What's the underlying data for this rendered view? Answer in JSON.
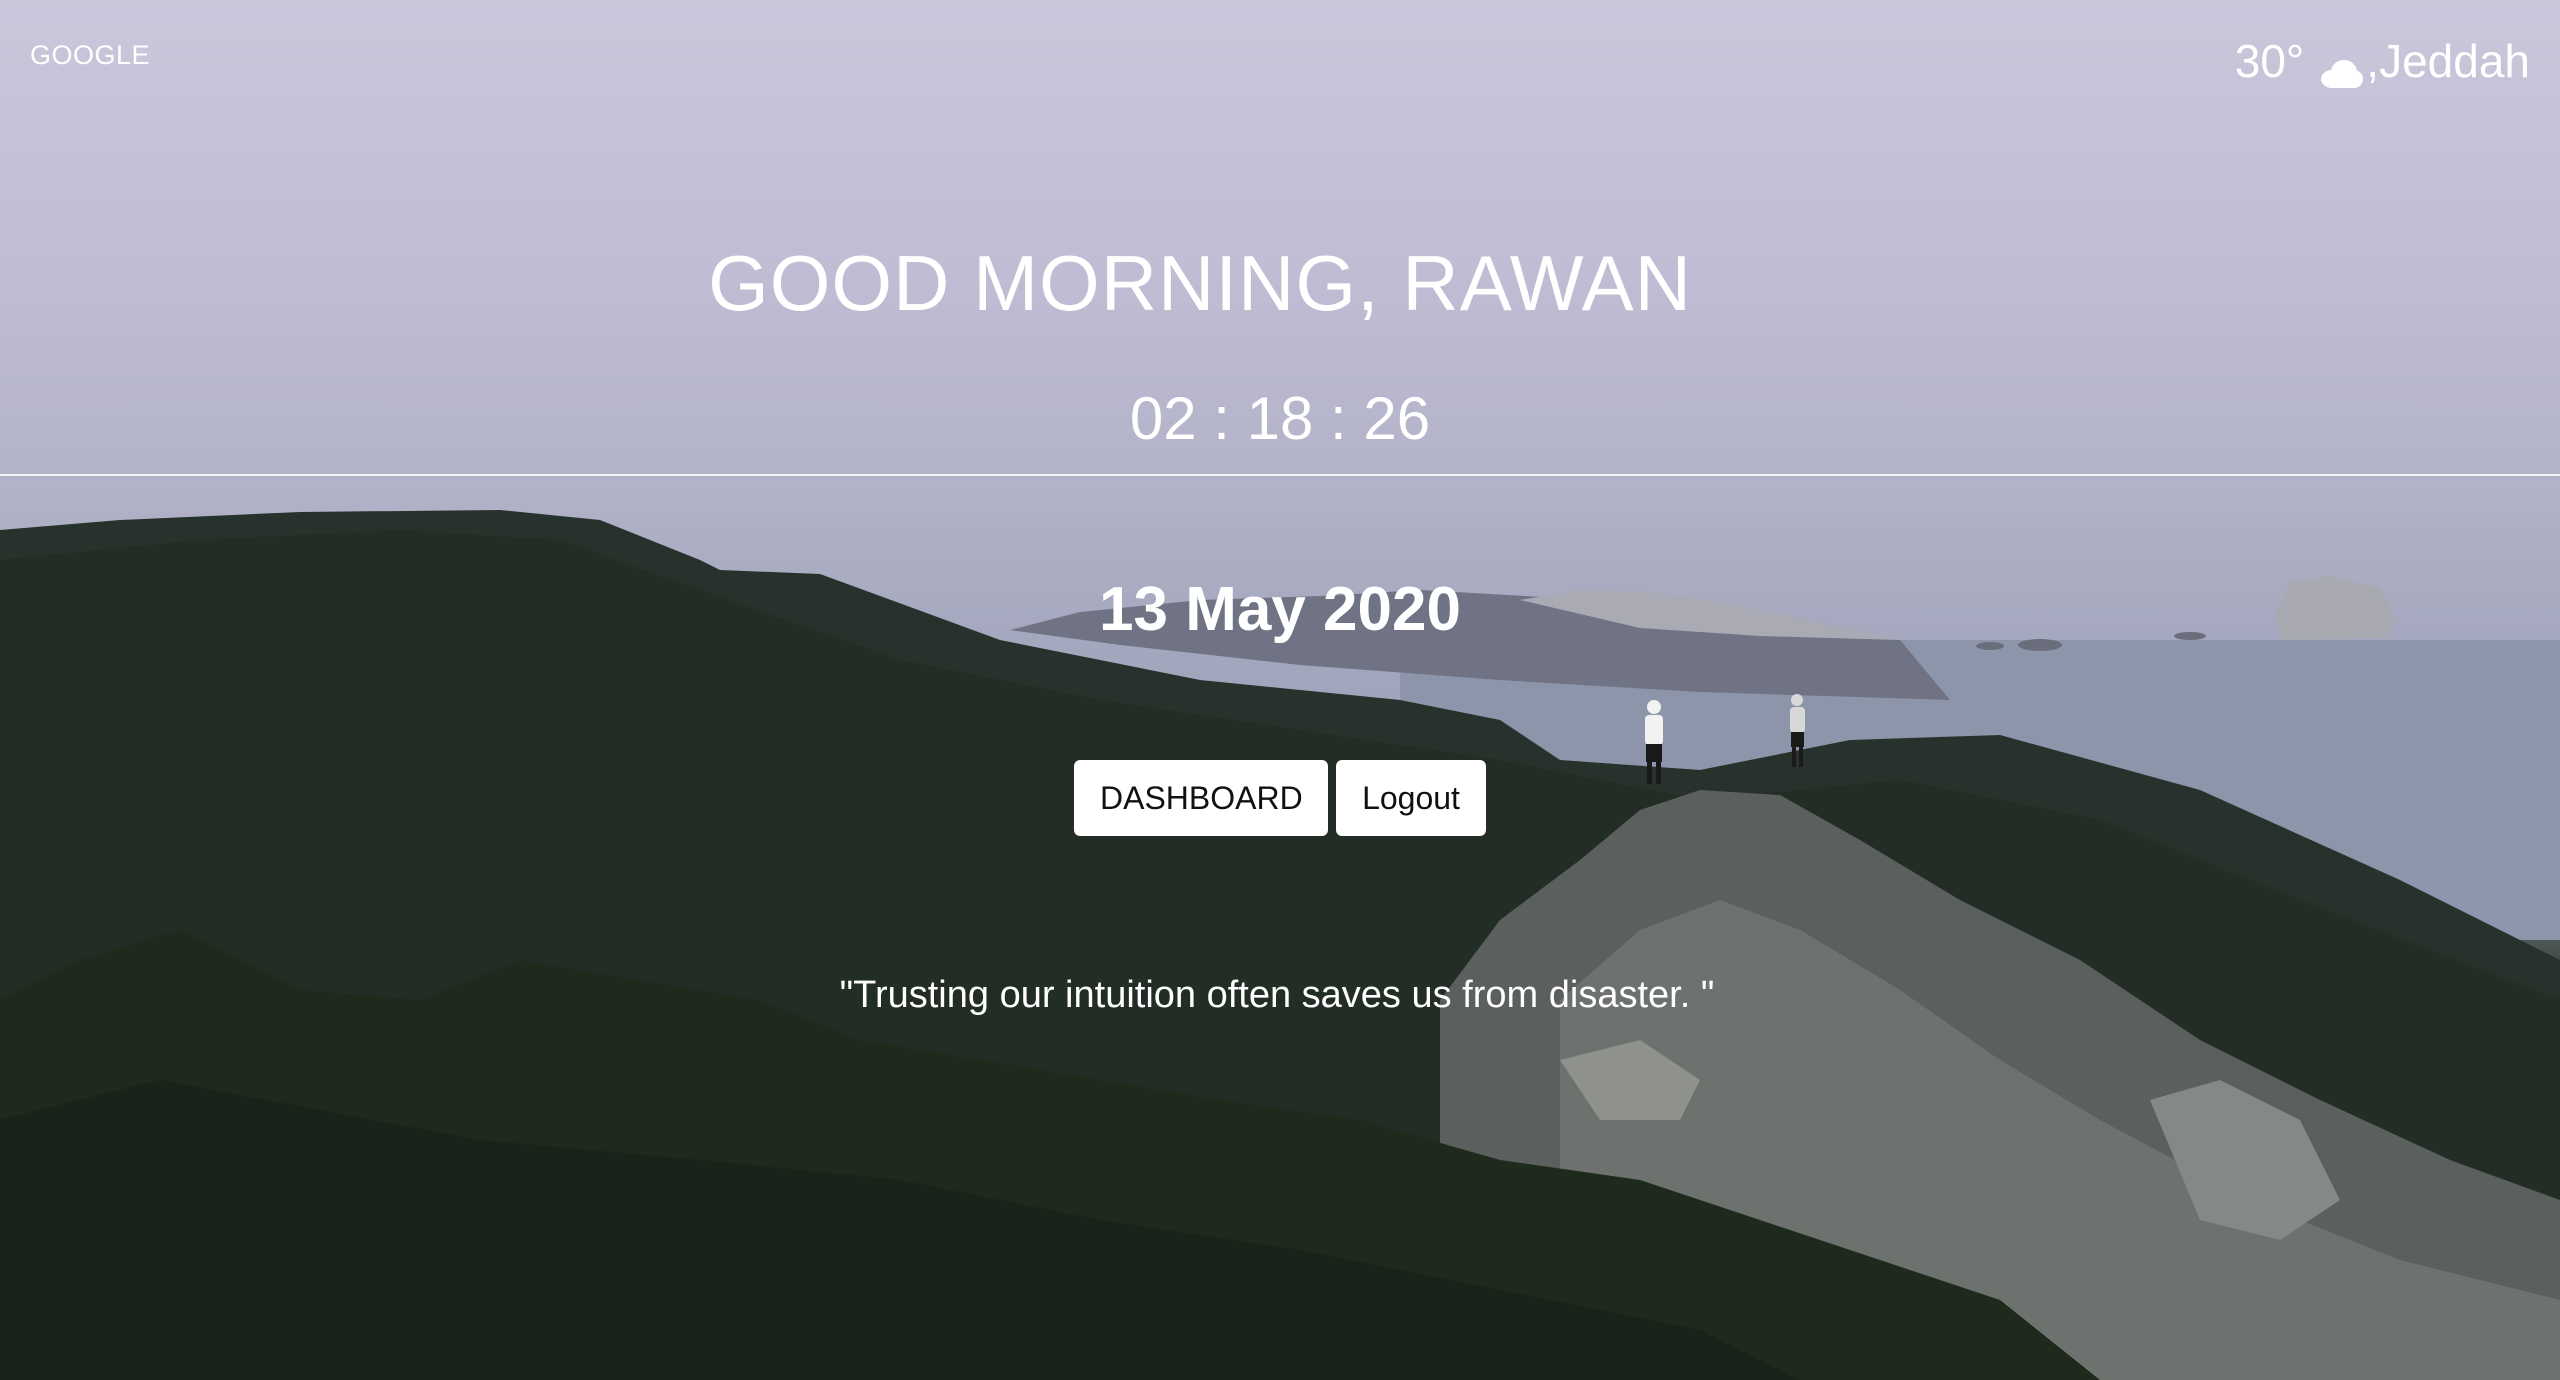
{
  "header": {
    "google_link": "GOOGLE"
  },
  "weather": {
    "temperature": "30°",
    "icon": "cloud-icon",
    "city_prefix": ", ",
    "city": "Jeddah"
  },
  "main": {
    "greeting": "GOOD MORNING, RAWAN",
    "clock": "02 : 18 : 26",
    "date": "13 May 2020",
    "dashboard_button": "DASHBOARD",
    "logout_button": "Logout",
    "quote": "\"Trusting our intuition often saves us from disaster. \""
  },
  "colors": {
    "text": "#ffffff",
    "button_bg": "#ffffff",
    "button_text": "#111111"
  }
}
